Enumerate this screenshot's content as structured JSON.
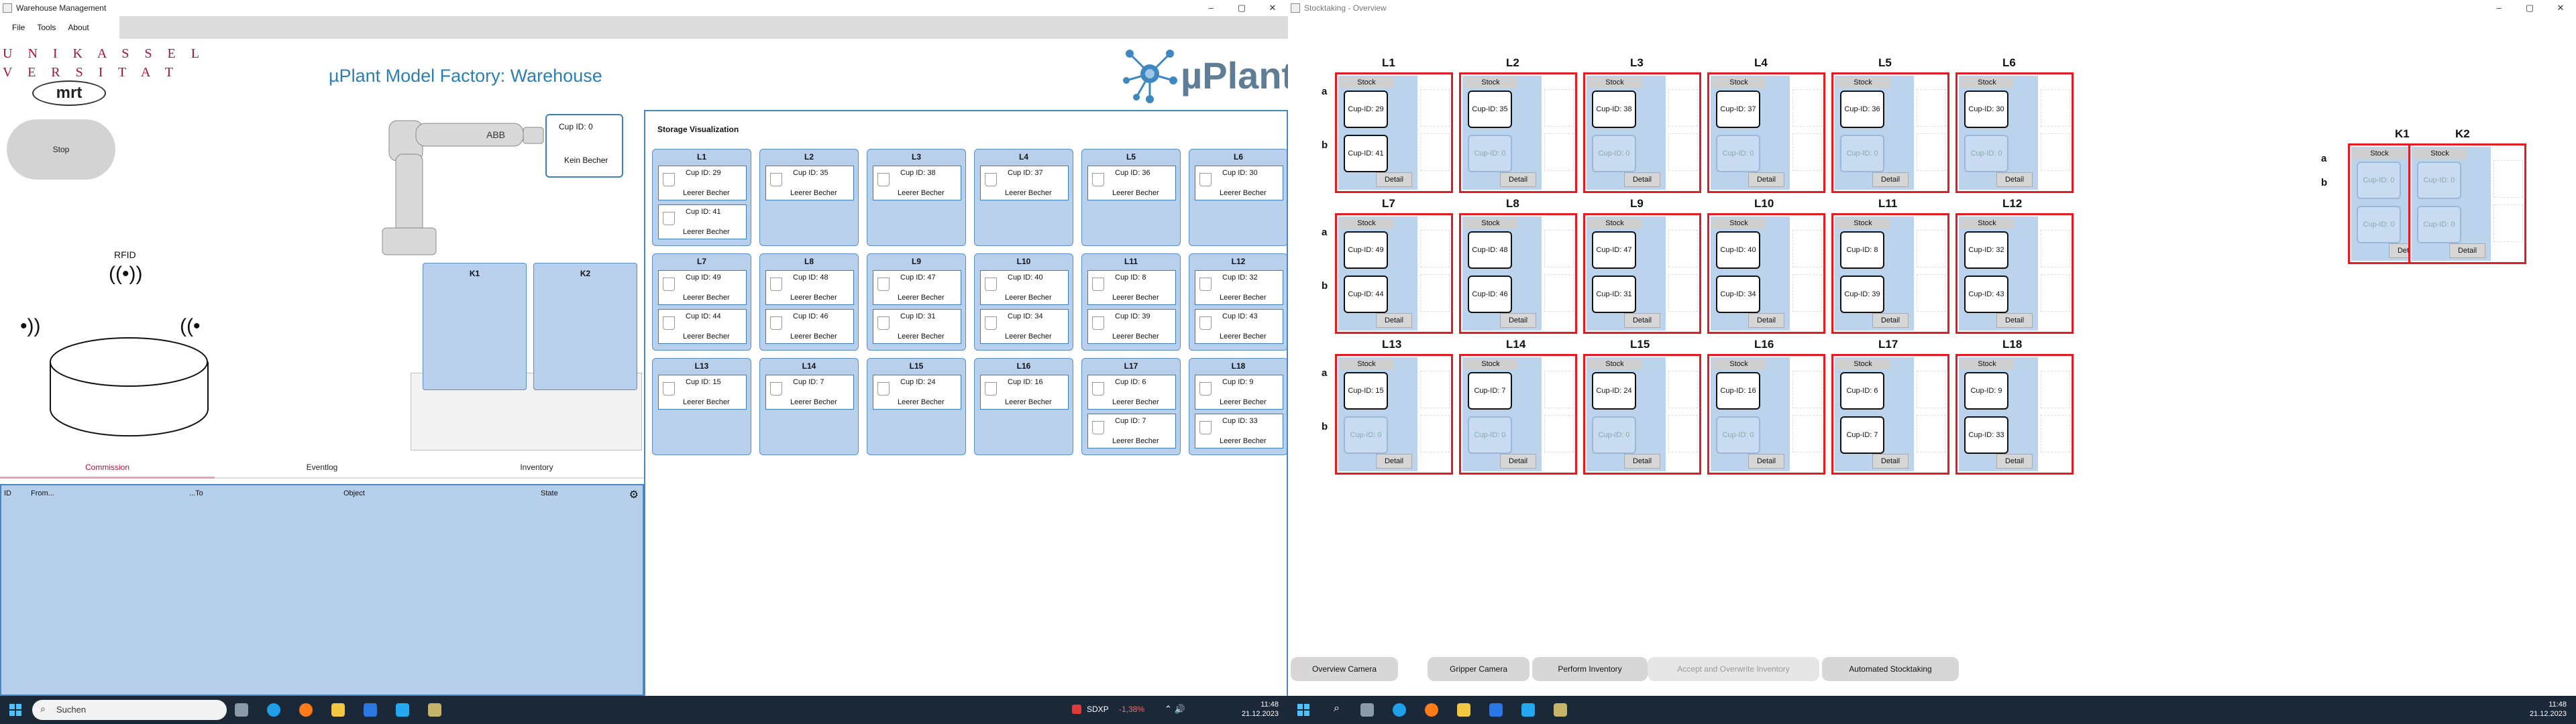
{
  "left_window": {
    "title": "Warehouse Management",
    "controls": [
      "–",
      "▢",
      "✕"
    ],
    "menu": [
      "File",
      "Tools",
      "About"
    ],
    "logo_text_1": "U N I K A S S E L",
    "logo_text_2": "V E R S I T A T",
    "logo_mrt": "mrt",
    "stop_label": "Stop",
    "main_title": "µPlant Model Factory: Warehouse",
    "brand": "µPlant",
    "rfid_label": "RFID",
    "gripper_cup": {
      "id": "Cup ID: 0",
      "name": "Kein Becher"
    },
    "k_boxes": [
      "K1",
      "K2"
    ],
    "tabs": [
      "Commission",
      "Eventlog",
      "Inventory"
    ],
    "grid_headers": [
      "ID",
      "From...",
      "...To",
      "Object",
      "State"
    ],
    "storage_title": "Storage Visualization",
    "storage": [
      {
        "label": "L1",
        "cups": [
          {
            "id": "Cup ID: 29",
            "name": "Leerer Becher"
          },
          {
            "id": "Cup ID: 41",
            "name": "Leerer Becher"
          }
        ]
      },
      {
        "label": "L2",
        "cups": [
          {
            "id": "Cup ID: 35",
            "name": "Leerer Becher"
          }
        ]
      },
      {
        "label": "L3",
        "cups": [
          {
            "id": "Cup ID: 38",
            "name": "Leerer Becher"
          }
        ]
      },
      {
        "label": "L4",
        "cups": [
          {
            "id": "Cup ID: 37",
            "name": "Leerer Becher"
          }
        ]
      },
      {
        "label": "L5",
        "cups": [
          {
            "id": "Cup ID: 36",
            "name": "Leerer Becher"
          }
        ]
      },
      {
        "label": "L6",
        "cups": [
          {
            "id": "Cup ID: 30",
            "name": "Leerer Becher"
          }
        ]
      },
      {
        "label": "L7",
        "cups": [
          {
            "id": "Cup ID: 49",
            "name": "Leerer Becher"
          },
          {
            "id": "Cup ID: 44",
            "name": "Leerer Becher"
          }
        ]
      },
      {
        "label": "L8",
        "cups": [
          {
            "id": "Cup ID: 48",
            "name": "Leerer Becher"
          },
          {
            "id": "Cup ID: 46",
            "name": "Leerer Becher"
          }
        ]
      },
      {
        "label": "L9",
        "cups": [
          {
            "id": "Cup ID: 47",
            "name": "Leerer Becher"
          },
          {
            "id": "Cup ID: 31",
            "name": "Leerer Becher"
          }
        ]
      },
      {
        "label": "L10",
        "cups": [
          {
            "id": "Cup ID: 40",
            "name": "Leerer Becher"
          },
          {
            "id": "Cup ID: 34",
            "name": "Leerer Becher"
          }
        ]
      },
      {
        "label": "L11",
        "cups": [
          {
            "id": "Cup ID: 8",
            "name": "Leerer Becher"
          },
          {
            "id": "Cup ID: 39",
            "name": "Leerer Becher"
          }
        ]
      },
      {
        "label": "L12",
        "cups": [
          {
            "id": "Cup ID: 32",
            "name": "Leerer Becher"
          },
          {
            "id": "Cup ID: 43",
            "name": "Leerer Becher"
          }
        ]
      },
      {
        "label": "L13",
        "cups": [
          {
            "id": "Cup ID: 15",
            "name": "Leerer Becher"
          }
        ]
      },
      {
        "label": "L14",
        "cups": [
          {
            "id": "Cup ID: 7",
            "name": "Leerer Becher"
          }
        ]
      },
      {
        "label": "L15",
        "cups": [
          {
            "id": "Cup ID: 24",
            "name": "Leerer Becher"
          }
        ]
      },
      {
        "label": "L16",
        "cups": [
          {
            "id": "Cup ID: 16",
            "name": "Leerer Becher"
          }
        ]
      },
      {
        "label": "L17",
        "cups": [
          {
            "id": "Cup ID: 6",
            "name": "Leerer Becher"
          },
          {
            "id": "Cup ID: 7",
            "name": "Leerer Becher"
          }
        ]
      },
      {
        "label": "L18",
        "cups": [
          {
            "id": "Cup ID: 9",
            "name": "Leerer Becher"
          },
          {
            "id": "Cup ID: 33",
            "name": "Leerer Becher"
          }
        ]
      }
    ]
  },
  "taskbar_left": {
    "search_placeholder": "Suchen",
    "ticker": "SDXP",
    "ticker_change": "-1,38%",
    "time": "11:48",
    "date": "21.12.2023"
  },
  "right_window": {
    "title": "Stocktaking - Overview",
    "controls": [
      "–",
      "▢",
      "✕"
    ],
    "row_labels": [
      "a",
      "b"
    ],
    "stock_label": "Stock",
    "detail_label": "Detail",
    "slots": [
      {
        "label": "L1",
        "a": "Cup-ID: 29",
        "b": "Cup-ID: 41",
        "a_empty": false,
        "b_empty": false
      },
      {
        "label": "L2",
        "a": "Cup-ID: 35",
        "b": "Cup-ID: 0",
        "a_empty": false,
        "b_empty": true
      },
      {
        "label": "L3",
        "a": "Cup-ID: 38",
        "b": "Cup-ID: 0",
        "a_empty": false,
        "b_empty": true
      },
      {
        "label": "L4",
        "a": "Cup-ID: 37",
        "b": "Cup-ID: 0",
        "a_empty": false,
        "b_empty": true
      },
      {
        "label": "L5",
        "a": "Cup-ID: 36",
        "b": "Cup-ID: 0",
        "a_empty": false,
        "b_empty": true
      },
      {
        "label": "L6",
        "a": "Cup-ID: 30",
        "b": "Cup-ID: 0",
        "a_empty": false,
        "b_empty": true
      },
      {
        "label": "L7",
        "a": "Cup-ID: 49",
        "b": "Cup-ID: 44",
        "a_empty": false,
        "b_empty": false
      },
      {
        "label": "L8",
        "a": "Cup-ID: 48",
        "b": "Cup-ID: 46",
        "a_empty": false,
        "b_empty": false
      },
      {
        "label": "L9",
        "a": "Cup-ID: 47",
        "b": "Cup-ID: 31",
        "a_empty": false,
        "b_empty": false
      },
      {
        "label": "L10",
        "a": "Cup-ID: 40",
        "b": "Cup-ID: 34",
        "a_empty": false,
        "b_empty": false
      },
      {
        "label": "L11",
        "a": "Cup-ID: 8",
        "b": "Cup-ID: 39",
        "a_empty": false,
        "b_empty": false
      },
      {
        "label": "L12",
        "a": "Cup-ID: 32",
        "b": "Cup-ID: 43",
        "a_empty": false,
        "b_empty": false
      },
      {
        "label": "L13",
        "a": "Cup-ID: 15",
        "b": "Cup-ID: 0",
        "a_empty": false,
        "b_empty": true
      },
      {
        "label": "L14",
        "a": "Cup-ID: 7",
        "b": "Cup-ID: 0",
        "a_empty": false,
        "b_empty": true
      },
      {
        "label": "L15",
        "a": "Cup-ID: 24",
        "b": "Cup-ID: 0",
        "a_empty": false,
        "b_empty": true
      },
      {
        "label": "L16",
        "a": "Cup-ID: 16",
        "b": "Cup-ID: 0",
        "a_empty": false,
        "b_empty": true
      },
      {
        "label": "L17",
        "a": "Cup-ID: 6",
        "b": "Cup-ID: 7",
        "a_empty": false,
        "b_empty": false
      },
      {
        "label": "L18",
        "a": "Cup-ID: 9",
        "b": "Cup-ID: 33",
        "a_empty": false,
        "b_empty": false
      }
    ],
    "k_slots": [
      {
        "label": "K1",
        "a": "Cup-ID: 0",
        "b": "Cup-ID: 0",
        "a_empty": true,
        "b_empty": true
      },
      {
        "label": "K2",
        "a": "Cup-ID: 0",
        "b": "Cup-ID: 0",
        "a_empty": true,
        "b_empty": true
      }
    ],
    "buttons": [
      {
        "label": "Overview Camera",
        "enabled": true
      },
      {
        "label": "Gripper Camera",
        "enabled": true
      },
      {
        "label": "Perform Inventory",
        "enabled": true
      },
      {
        "label": "Accept and Overwrite Inventory",
        "enabled": false
      },
      {
        "label": "Automated Stocktaking",
        "enabled": true
      }
    ]
  },
  "taskbar_right": {
    "time": "11:48",
    "date": "21.12.2023"
  },
  "colors": {
    "accent_blue": "#2d7fb0",
    "cell_blue": "#b8d0ec",
    "alert_red": "#e31b23",
    "uni_red": "#a5143a",
    "taskbar": "#1b2838"
  }
}
